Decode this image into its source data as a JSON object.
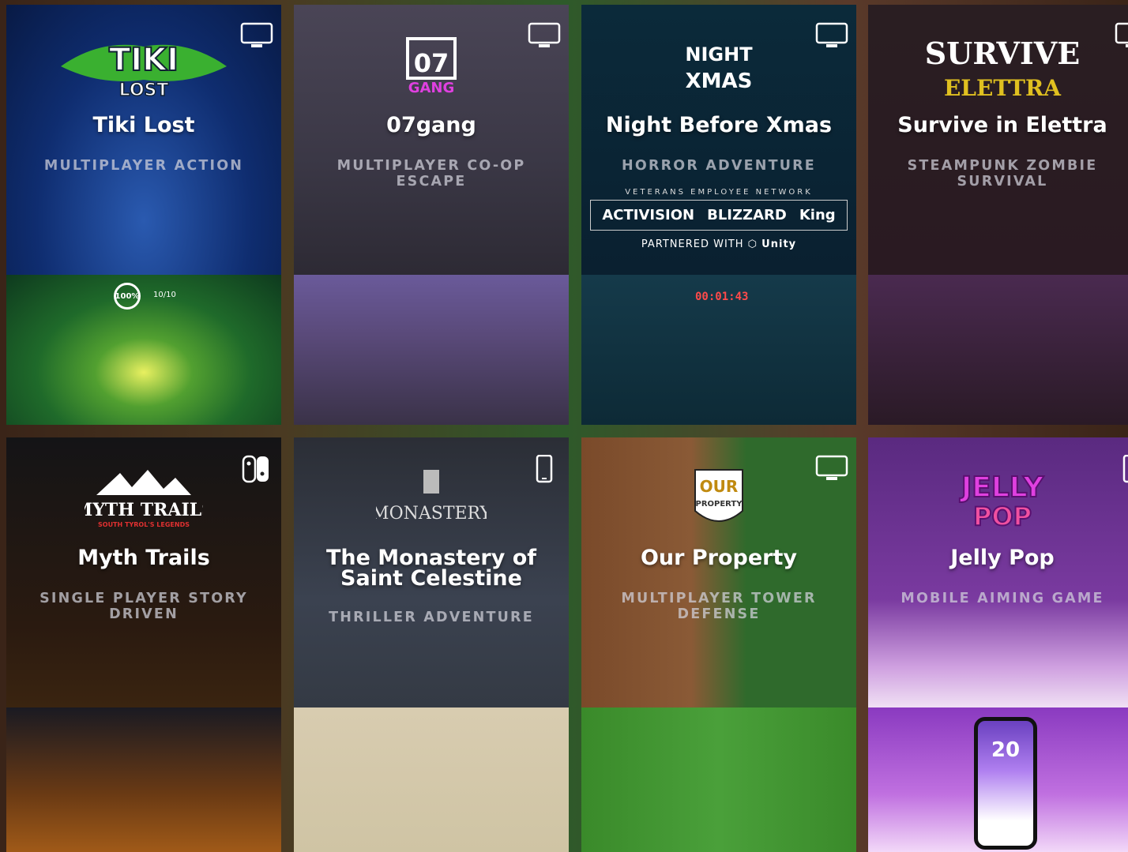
{
  "games": [
    {
      "id": "tiki-lost",
      "title": "Tiki Lost",
      "genre": "MULTIPLAYER ACTION",
      "platform_icon": "monitor-icon",
      "logo": {
        "line1": "TIKI",
        "line2": "LOST"
      }
    },
    {
      "id": "07gang",
      "title": "07gang",
      "genre": "MULTIPLAYER CO-OP ESCAPE",
      "platform_icon": "monitor-icon",
      "logo": {
        "line1": "07",
        "line2": "GANG"
      }
    },
    {
      "id": "night-before-xmas",
      "title": "Night Before Xmas",
      "genre": "HORROR ADVENTURE",
      "platform_icon": "monitor-icon",
      "logo": {
        "line1": "NIGHT",
        "line2": "XMAS"
      },
      "sponsor": {
        "network": "VETERANS EMPLOYEE NETWORK",
        "brands": [
          "ACTIVISION",
          "BLIZZARD",
          "King"
        ],
        "partner": "PARTNERED WITH",
        "partner_brand": "Unity"
      }
    },
    {
      "id": "survive-in-elettra",
      "title": "Survive in Elettra",
      "genre": "STEAMPUNK ZOMBIE SURVIVAL",
      "platform_icon": "monitor-icon",
      "logo": {
        "line1": "SURVIVE",
        "line2": "ELETTRA"
      }
    },
    {
      "id": "myth-trails",
      "title": "Myth Trails",
      "genre": "SINGLE PLAYER STORY DRIVEN",
      "platform_icon": "switch-icon",
      "logo": {
        "line1": "MYTH TRAILS",
        "line2": "SOUTH TYROL'S LEGENDS"
      }
    },
    {
      "id": "monastery",
      "title": "The Monastery of Saint Celestine",
      "genre": "THRILLER ADVENTURE",
      "platform_icon": "mobile-icon",
      "logo": {
        "line1": "MONASTERY",
        "line2": ""
      }
    },
    {
      "id": "our-property",
      "title": "Our Property",
      "genre": "MULTIPLAYER TOWER DEFENSE",
      "platform_icon": "monitor-icon",
      "logo": {
        "line1": "OUR",
        "line2": "PROPERTY"
      }
    },
    {
      "id": "jelly-pop",
      "title": "Jelly Pop",
      "genre": "MOBILE AIMING GAME",
      "platform_icon": "mobile-icon",
      "logo": {
        "line1": "JELLY",
        "line2": "POP"
      }
    }
  ],
  "hud": {
    "tiki_pct": "100%",
    "tiki_count": "10/10",
    "xmas_timer": "00:01:43",
    "jelly_score": "20"
  }
}
